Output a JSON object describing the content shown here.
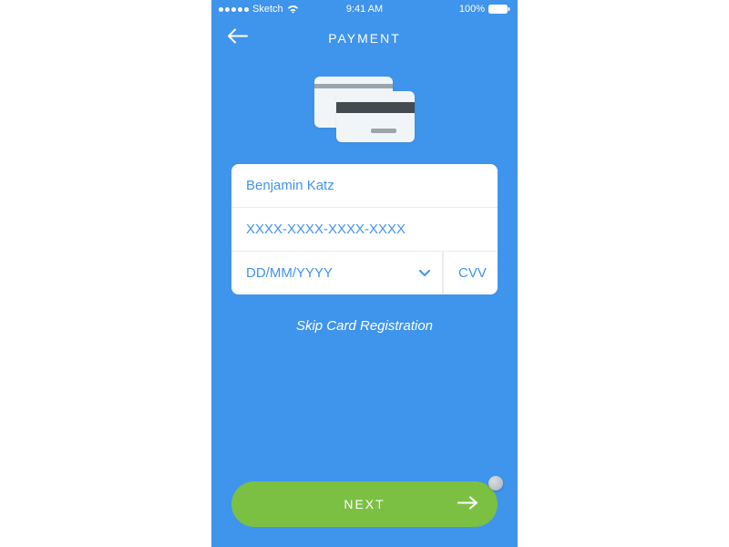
{
  "status": {
    "carrier": "Sketch",
    "time": "9:41 AM",
    "battery": "100%"
  },
  "nav": {
    "title": "PAYMENT"
  },
  "form": {
    "name_value": "Benjamin Katz",
    "card_placeholder": "XXXX-XXXX-XXXX-XXXX",
    "date_placeholder": "DD/MM/YYYY",
    "cvv_placeholder": "CVV"
  },
  "skip_label": "Skip Card Registration",
  "next_label": "NEXT"
}
